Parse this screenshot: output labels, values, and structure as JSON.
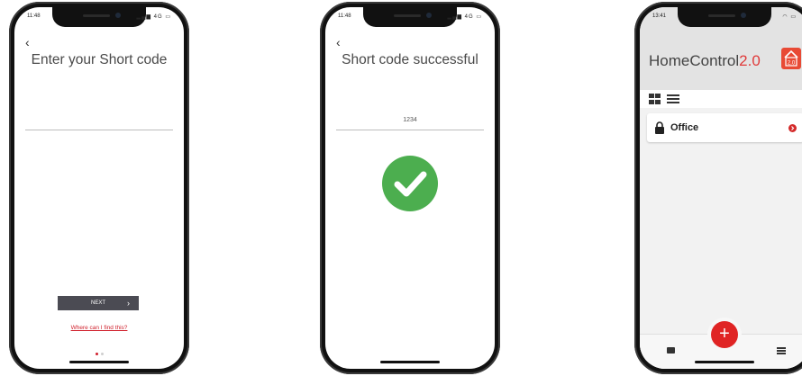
{
  "phone1": {
    "status_time": "11:48",
    "status_icons": "▂▄▆ 4G ▭",
    "back_icon": "‹",
    "title": "Enter your Short code",
    "next_label": "NEXT",
    "next_chevron": "›",
    "help_link": "Where can I find this?",
    "page_dots": [
      {
        "active": true
      },
      {
        "active": false
      }
    ],
    "colors": {
      "button": "#4b4b53",
      "link": "#d0202c"
    }
  },
  "phone2": {
    "status_time": "11:48",
    "status_icons": "▂▄▆ 4G ▭",
    "back_icon": "‹",
    "title": "Short code successful",
    "code_value": "1234",
    "success_icon": "check-circle-icon",
    "colors": {
      "success": "#4cae4f"
    }
  },
  "phone3": {
    "status_time": "13:41",
    "status_icons": "◠ ▭",
    "brand_name": "HomeControl",
    "brand_version": "2.0",
    "logo_text": "2.0",
    "rooms": [
      {
        "name": "Office",
        "icon": "lock-icon"
      }
    ],
    "add_label": "+",
    "colors": {
      "accent": "#e02424",
      "header": "#e3e3e3"
    }
  }
}
